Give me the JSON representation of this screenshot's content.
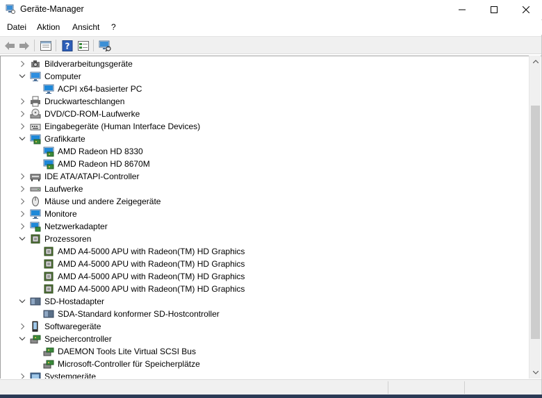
{
  "window": {
    "title": "Geräte-Manager"
  },
  "menu": {
    "items": [
      "Datei",
      "Aktion",
      "Ansicht",
      "?"
    ]
  },
  "toolbar": {
    "buttons": [
      "back-arrow",
      "forward-arrow",
      "properties",
      "help",
      "details-view",
      "scan-hardware"
    ]
  },
  "tree": [
    {
      "label": "Bildverarbeitungsgeräte",
      "level": 0,
      "expanded": false,
      "icon": "camera-icon"
    },
    {
      "label": "Computer",
      "level": 0,
      "expanded": true,
      "icon": "computer-icon"
    },
    {
      "label": "ACPI x64-basierter PC",
      "level": 1,
      "icon": "monitor-icon"
    },
    {
      "label": "Druckwarteschlangen",
      "level": 0,
      "expanded": false,
      "icon": "printer-icon"
    },
    {
      "label": "DVD/CD-ROM-Laufwerke",
      "level": 0,
      "expanded": false,
      "icon": "dvd-icon"
    },
    {
      "label": "Eingabegeräte (Human Interface Devices)",
      "level": 0,
      "expanded": false,
      "icon": "keyboard-icon"
    },
    {
      "label": "Grafikkarte",
      "level": 0,
      "expanded": true,
      "icon": "display-adapter-icon"
    },
    {
      "label": "AMD Radeon HD 8330",
      "level": 1,
      "icon": "display-adapter-icon"
    },
    {
      "label": "AMD Radeon HD 8670M",
      "level": 1,
      "icon": "display-adapter-icon"
    },
    {
      "label": "IDE ATA/ATAPI-Controller",
      "level": 0,
      "expanded": false,
      "icon": "ide-controller-icon"
    },
    {
      "label": "Laufwerke",
      "level": 0,
      "expanded": false,
      "icon": "drive-icon"
    },
    {
      "label": "Mäuse und andere Zeigegeräte",
      "level": 0,
      "expanded": false,
      "icon": "mouse-icon"
    },
    {
      "label": "Monitore",
      "level": 0,
      "expanded": false,
      "icon": "monitor-icon"
    },
    {
      "label": "Netzwerkadapter",
      "level": 0,
      "expanded": false,
      "icon": "network-icon"
    },
    {
      "label": "Prozessoren",
      "level": 0,
      "expanded": true,
      "icon": "processor-icon"
    },
    {
      "label": "AMD A4-5000 APU with Radeon(TM) HD Graphics",
      "level": 1,
      "icon": "processor-icon"
    },
    {
      "label": "AMD A4-5000 APU with Radeon(TM) HD Graphics",
      "level": 1,
      "icon": "processor-icon"
    },
    {
      "label": "AMD A4-5000 APU with Radeon(TM) HD Graphics",
      "level": 1,
      "icon": "processor-icon"
    },
    {
      "label": "AMD A4-5000 APU with Radeon(TM) HD Graphics",
      "level": 1,
      "icon": "processor-icon"
    },
    {
      "label": "SD-Hostadapter",
      "level": 0,
      "expanded": true,
      "icon": "sd-host-icon"
    },
    {
      "label": "SDA-Standard konformer SD-Hostcontroller",
      "level": 1,
      "icon": "sd-host-icon"
    },
    {
      "label": "Softwaregeräte",
      "level": 0,
      "expanded": false,
      "icon": "software-device-icon"
    },
    {
      "label": "Speichercontroller",
      "level": 0,
      "expanded": true,
      "icon": "storage-controller-icon"
    },
    {
      "label": "DAEMON Tools Lite Virtual SCSI Bus",
      "level": 1,
      "icon": "storage-controller-icon"
    },
    {
      "label": "Microsoft-Controller für Speicherplätze",
      "level": 1,
      "icon": "storage-controller-icon"
    },
    {
      "label": "Systemgeräte",
      "level": 0,
      "expanded": false,
      "icon": "system-device-icon"
    }
  ],
  "colors": {
    "accent_blue": "#1e88d8",
    "chevron": "#555555",
    "processor_green": "#4e7a2e"
  }
}
